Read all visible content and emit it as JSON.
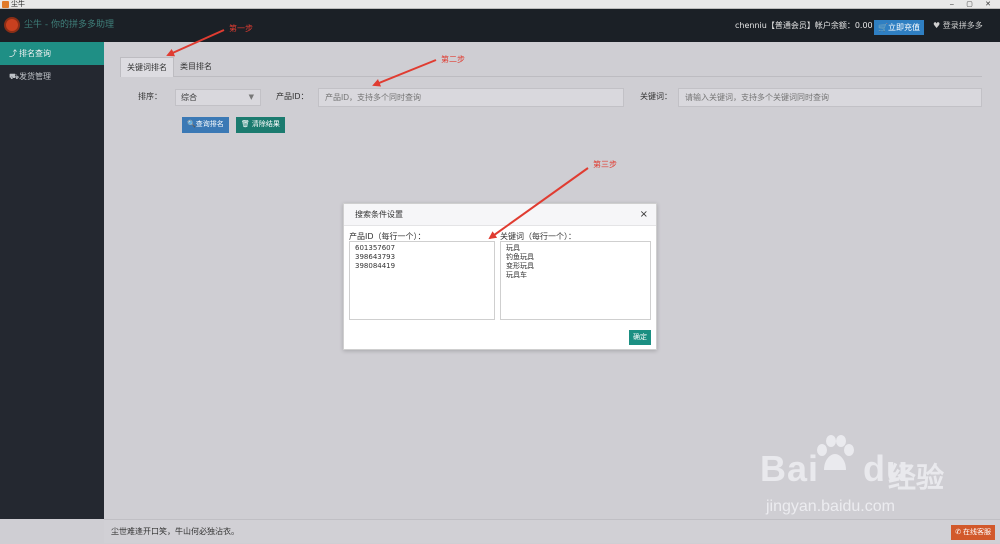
{
  "window": {
    "title": "尘牛"
  },
  "header": {
    "brand": "尘牛 - 你的拼多多助理",
    "account_text": "chenniu【普通会员】帐户余额：0.00 元",
    "recharge_label": "立即充值",
    "favorite_label": "登录拼多多"
  },
  "sidebar": {
    "items": [
      {
        "label": "排名查询",
        "icon": "chart-line-icon"
      },
      {
        "label": "发货管理",
        "icon": "truck-icon"
      }
    ]
  },
  "main": {
    "tabs": [
      {
        "label": "关键词排名"
      },
      {
        "label": "类目排名"
      }
    ],
    "sort_label": "排序：",
    "sort_value": "综合",
    "product_id_label": "产品ID：",
    "product_id_placeholder": "产品ID，支持多个同时查询",
    "keyword_label": "关键词：",
    "keyword_placeholder": "请输入关键词，支持多个关键词同时查询",
    "query_button": "查询排名",
    "clear_button": "清除结果"
  },
  "modal": {
    "title": "搜索条件设置",
    "close": "×",
    "product_id_field_label": "产品ID（每行一个）：",
    "product_ids": "601357607\n398643793\n398084419",
    "keyword_field_label": "关键词（每行一个）：",
    "keywords": "玩具\n钓鱼玩具\n变形玩具\n玩具车",
    "ok_button": "确定"
  },
  "footer": {
    "quote": "尘世难逢开口笑，牛山何必独沾衣。",
    "service_button": "在线客服"
  },
  "annotations": {
    "step1": "第一步",
    "step2": "第二步",
    "step3": "第三步",
    "color": "#e03c31"
  },
  "watermark": {
    "brand": "Bai",
    "brand2": "du",
    "cn": "经验",
    "url": "jingyan.baidu.com"
  }
}
